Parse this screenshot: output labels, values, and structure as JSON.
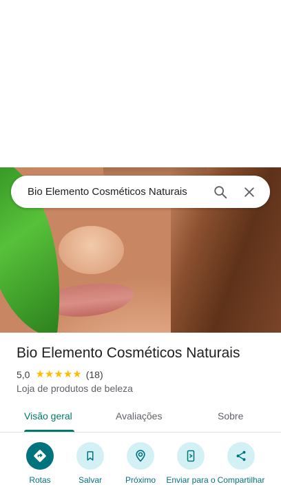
{
  "search": {
    "query": "Bio Elemento Cosméticos Naturais",
    "search_icon": "search-icon",
    "close_icon": "close-icon"
  },
  "place": {
    "name": "Bio Elemento Cosméticos Naturais",
    "rating": "5,0",
    "stars": 5,
    "review_count": "(18)",
    "category": "Loja de produtos de beleza"
  },
  "tabs": [
    {
      "label": "Visão geral",
      "active": true
    },
    {
      "label": "Avaliações",
      "active": false
    },
    {
      "label": "Sobre",
      "active": false
    }
  ],
  "actions": [
    {
      "label": "Rotas",
      "icon": "directions-icon"
    },
    {
      "label": "Salvar",
      "icon": "bookmark-icon"
    },
    {
      "label": "Próximo",
      "icon": "nearby-icon"
    },
    {
      "label": "Enviar para o",
      "icon": "send-to-phone-icon"
    },
    {
      "label": "Compartilhar",
      "icon": "share-icon"
    }
  ],
  "colors": {
    "accent": "#00796b",
    "action_bg": "#d3f1f4",
    "primary_action_bg": "#00737c",
    "star": "#fbbc04"
  }
}
